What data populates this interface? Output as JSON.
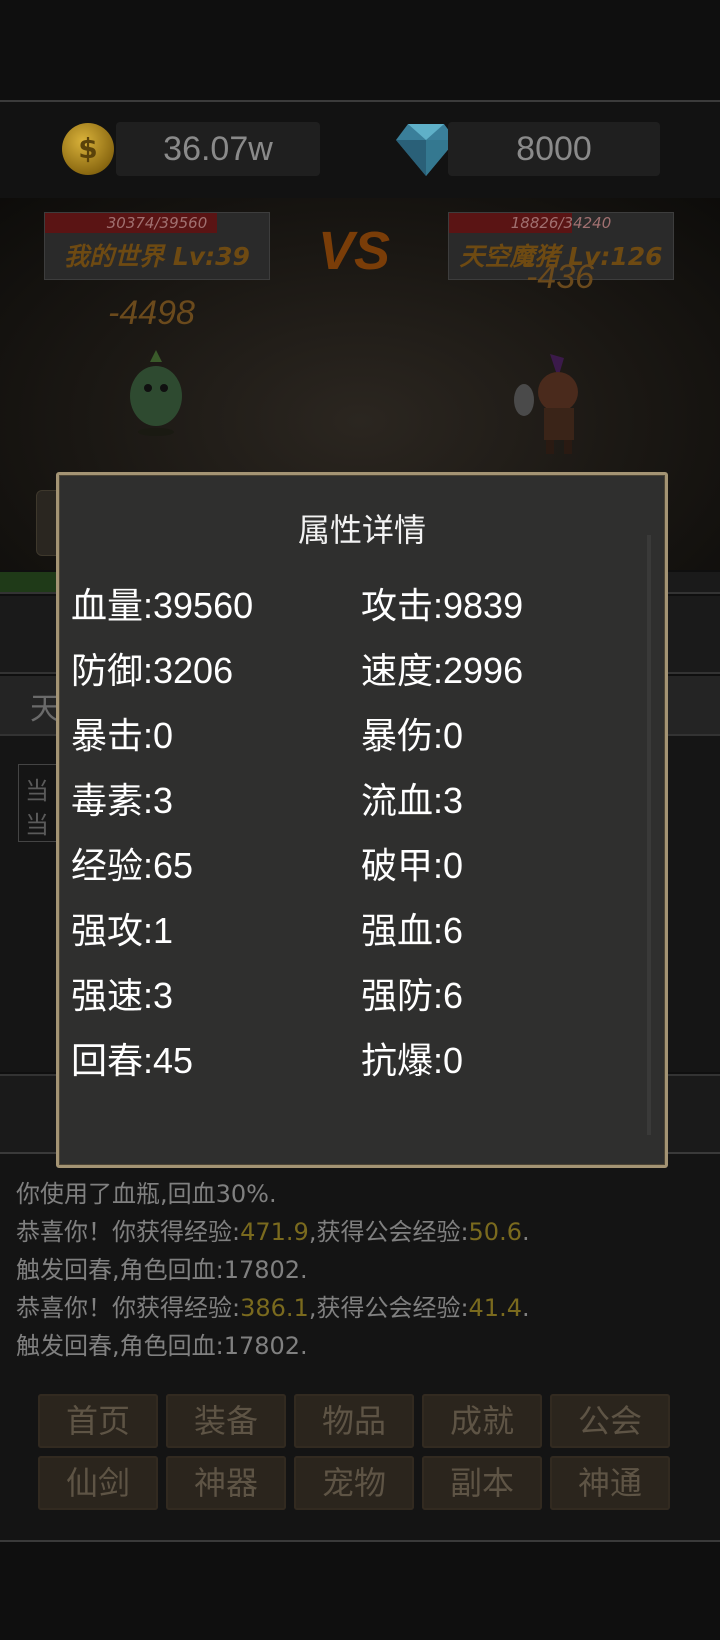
{
  "currency": {
    "gold": "36.07w",
    "diamond": "8000"
  },
  "battle": {
    "player": {
      "hp_text": "30374/39560",
      "hp_fraction": 0.768,
      "name": "我的世界 Lv:39"
    },
    "enemy": {
      "hp_text": "18826/34240",
      "hp_fraction": 0.55,
      "name": "天空魔猪 Lv:126"
    },
    "vs": "VS",
    "player_damage": "-4498",
    "enemy_damage": "-436"
  },
  "background": {
    "map_first_char": "天",
    "cur_labels": [
      "当",
      "当"
    ]
  },
  "dialog": {
    "title": "属性详情",
    "attributes": [
      "血量:39560",
      "攻击:9839",
      "防御:3206",
      "速度:2996",
      "暴击:0",
      "暴伤:0",
      "毒素:3",
      "流血:3",
      "经验:65",
      "破甲:0",
      "强攻:1",
      "强血:6",
      "强速:3",
      "强防:6",
      "回春:45",
      "抗爆:0"
    ]
  },
  "log": [
    {
      "parts": [
        "你使用了血瓶,回血30%."
      ]
    },
    {
      "parts": [
        "恭喜你！你获得经验:",
        "471.9",
        ",获得公会经验:",
        "50.6",
        "."
      ]
    },
    {
      "parts": [
        "触发回春,角色回血:17802."
      ]
    },
    {
      "parts": [
        "恭喜你！你获得经验:",
        "386.1",
        ",获得公会经验:",
        "41.4",
        "."
      ]
    },
    {
      "parts": [
        "触发回春,角色回血:17802."
      ]
    }
  ],
  "nav": {
    "row1": [
      "首页",
      "装备",
      "物品",
      "成就",
      "公会"
    ],
    "row2": [
      "仙剑",
      "神器",
      "宠物",
      "副本",
      "神通"
    ]
  },
  "colors": {
    "dialog_border": "#a49474",
    "log_highlight": "#7a6a1e",
    "hp_bar": "#5a1414"
  }
}
